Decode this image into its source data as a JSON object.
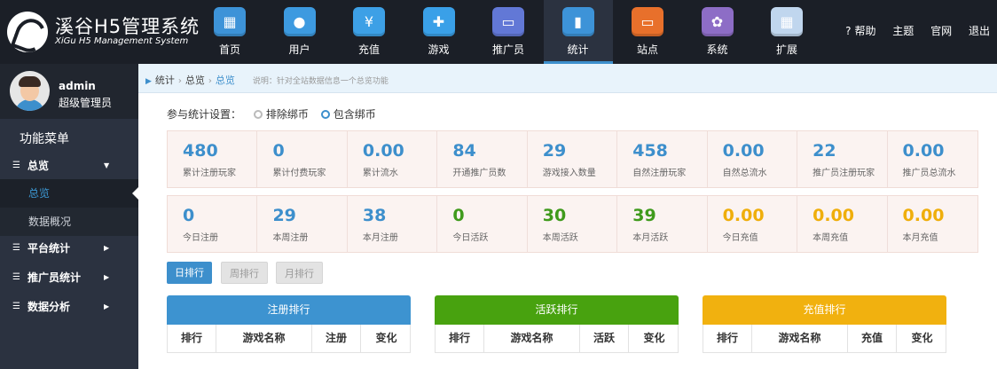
{
  "app": {
    "title": "溪谷H5管理系统",
    "subtitle": "XiGu H5 Management System"
  },
  "nav": [
    {
      "label": "首页",
      "icon": "storefront-icon",
      "color": "#3d93d8",
      "glyph": "▦"
    },
    {
      "label": "用户",
      "icon": "user-icon",
      "color": "#3d9ae0",
      "glyph": "●"
    },
    {
      "label": "充值",
      "icon": "wallet-icon",
      "color": "#3da0e6",
      "glyph": "¥"
    },
    {
      "label": "游戏",
      "icon": "gamepad-icon",
      "color": "#3aa0e8",
      "glyph": "✚"
    },
    {
      "label": "推广员",
      "icon": "card-icon",
      "color": "#6278d6",
      "glyph": "▭"
    },
    {
      "label": "统计",
      "icon": "bar-chart-icon",
      "color": "#3d93d8",
      "glyph": "▮"
    },
    {
      "label": "站点",
      "icon": "monitor-icon",
      "color": "#e8702b",
      "glyph": "▭"
    },
    {
      "label": "系统",
      "icon": "gear-icon",
      "color": "#8d6dc6",
      "glyph": "✿"
    },
    {
      "label": "扩展",
      "icon": "grid-icon",
      "color": "#c0d6ee",
      "glyph": "▦"
    }
  ],
  "nav_active_index": 5,
  "topright": {
    "help": "帮助",
    "theme": "主题",
    "site": "官网",
    "logout": "退出"
  },
  "user": {
    "name": "admin",
    "role": "超级管理员"
  },
  "sidebar": {
    "menu_title": "功能菜单",
    "items": [
      {
        "label": "总览",
        "expanded": true
      },
      {
        "label": "平台统计"
      },
      {
        "label": "推广员统计"
      },
      {
        "label": "数据分析"
      }
    ],
    "subitems": [
      {
        "label": "总览",
        "active": true
      },
      {
        "label": "数据概况"
      }
    ]
  },
  "breadcrumb": {
    "items": [
      "统计",
      "总览",
      "总览"
    ],
    "description": "说明：针对全站数据信息一个总览功能"
  },
  "settings": {
    "label": "参与统计设置：",
    "options": [
      "排除绑币",
      "包含绑币"
    ],
    "selected": "包含绑币"
  },
  "colors": {
    "blue": "#3d8fcc",
    "green": "#3f9a1c",
    "gold": "#efae0b"
  },
  "stats_row1": [
    {
      "value": "480",
      "label": "累计注册玩家"
    },
    {
      "value": "0",
      "label": "累计付费玩家"
    },
    {
      "value": "0.00",
      "label": "累计流水"
    },
    {
      "value": "84",
      "label": "开通推广员数"
    },
    {
      "value": "29",
      "label": "游戏接入数量"
    },
    {
      "value": "458",
      "label": "自然注册玩家"
    },
    {
      "value": "0.00",
      "label": "自然总流水"
    },
    {
      "value": "22",
      "label": "推广员注册玩家"
    },
    {
      "value": "0.00",
      "label": "推广员总流水"
    }
  ],
  "stats_row2": [
    {
      "value": "0",
      "label": "今日注册",
      "color": "#3d8fcc"
    },
    {
      "value": "29",
      "label": "本周注册",
      "color": "#3d8fcc"
    },
    {
      "value": "38",
      "label": "本月注册",
      "color": "#3d8fcc"
    },
    {
      "value": "0",
      "label": "今日活跃",
      "color": "#3f9a1c"
    },
    {
      "value": "30",
      "label": "本周活跃",
      "color": "#3f9a1c"
    },
    {
      "value": "39",
      "label": "本月活跃",
      "color": "#3f9a1c"
    },
    {
      "value": "0.00",
      "label": "今日充值",
      "color": "#efae0b"
    },
    {
      "value": "0.00",
      "label": "本周充值",
      "color": "#efae0b"
    },
    {
      "value": "0.00",
      "label": "本月充值",
      "color": "#efae0b"
    }
  ],
  "rank_tabs": [
    {
      "label": "日排行",
      "active": true
    },
    {
      "label": "周排行"
    },
    {
      "label": "月排行"
    }
  ],
  "rank_tables": [
    {
      "title": "注册排行",
      "color": "#3d93d0",
      "columns": [
        "排行",
        "游戏名称",
        "注册",
        "变化"
      ]
    },
    {
      "title": "活跃排行",
      "color": "#48a20f",
      "columns": [
        "排行",
        "游戏名称",
        "活跃",
        "变化"
      ]
    },
    {
      "title": "充值排行",
      "color": "#f1b10f",
      "columns": [
        "排行",
        "游戏名称",
        "充值",
        "变化"
      ]
    }
  ]
}
